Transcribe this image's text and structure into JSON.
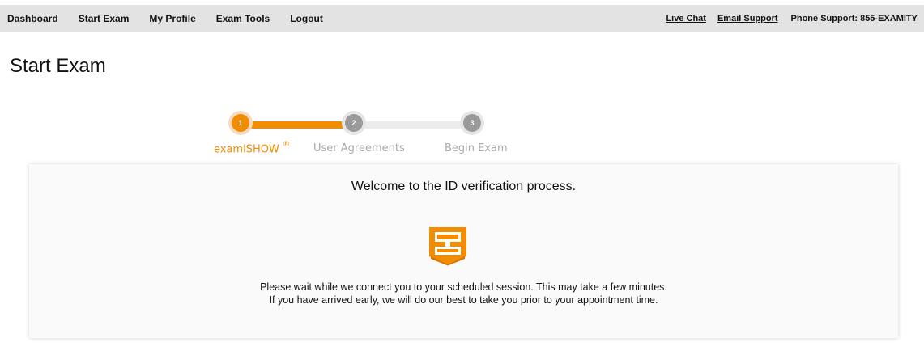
{
  "nav": {
    "items": [
      {
        "label": "Dashboard"
      },
      {
        "label": "Start Exam"
      },
      {
        "label": "My Profile"
      },
      {
        "label": "Exam Tools"
      },
      {
        "label": "Logout"
      }
    ],
    "support": {
      "live_chat": "Live Chat",
      "email_support": "Email Support",
      "phone": "Phone Support: 855-EXAMITY"
    }
  },
  "page_title": "Start Exam",
  "stepper": {
    "steps": [
      {
        "number": "1",
        "label": "examiSHOW",
        "mark": "®",
        "state": "active"
      },
      {
        "number": "2",
        "label": "User Agreements",
        "state": "pending"
      },
      {
        "number": "3",
        "label": "Begin Exam",
        "state": "pending"
      }
    ],
    "progress_fraction": 0.5,
    "accent_color": "#f28c00"
  },
  "card": {
    "welcome": "Welcome to the ID verification process.",
    "logo_icon": "examity-shield-logo",
    "message_line1": "Please wait while we connect you to your scheduled session. This may take a few minutes.",
    "message_line2": "If you have arrived early, we will do our best to take you prior to your appointment time."
  }
}
